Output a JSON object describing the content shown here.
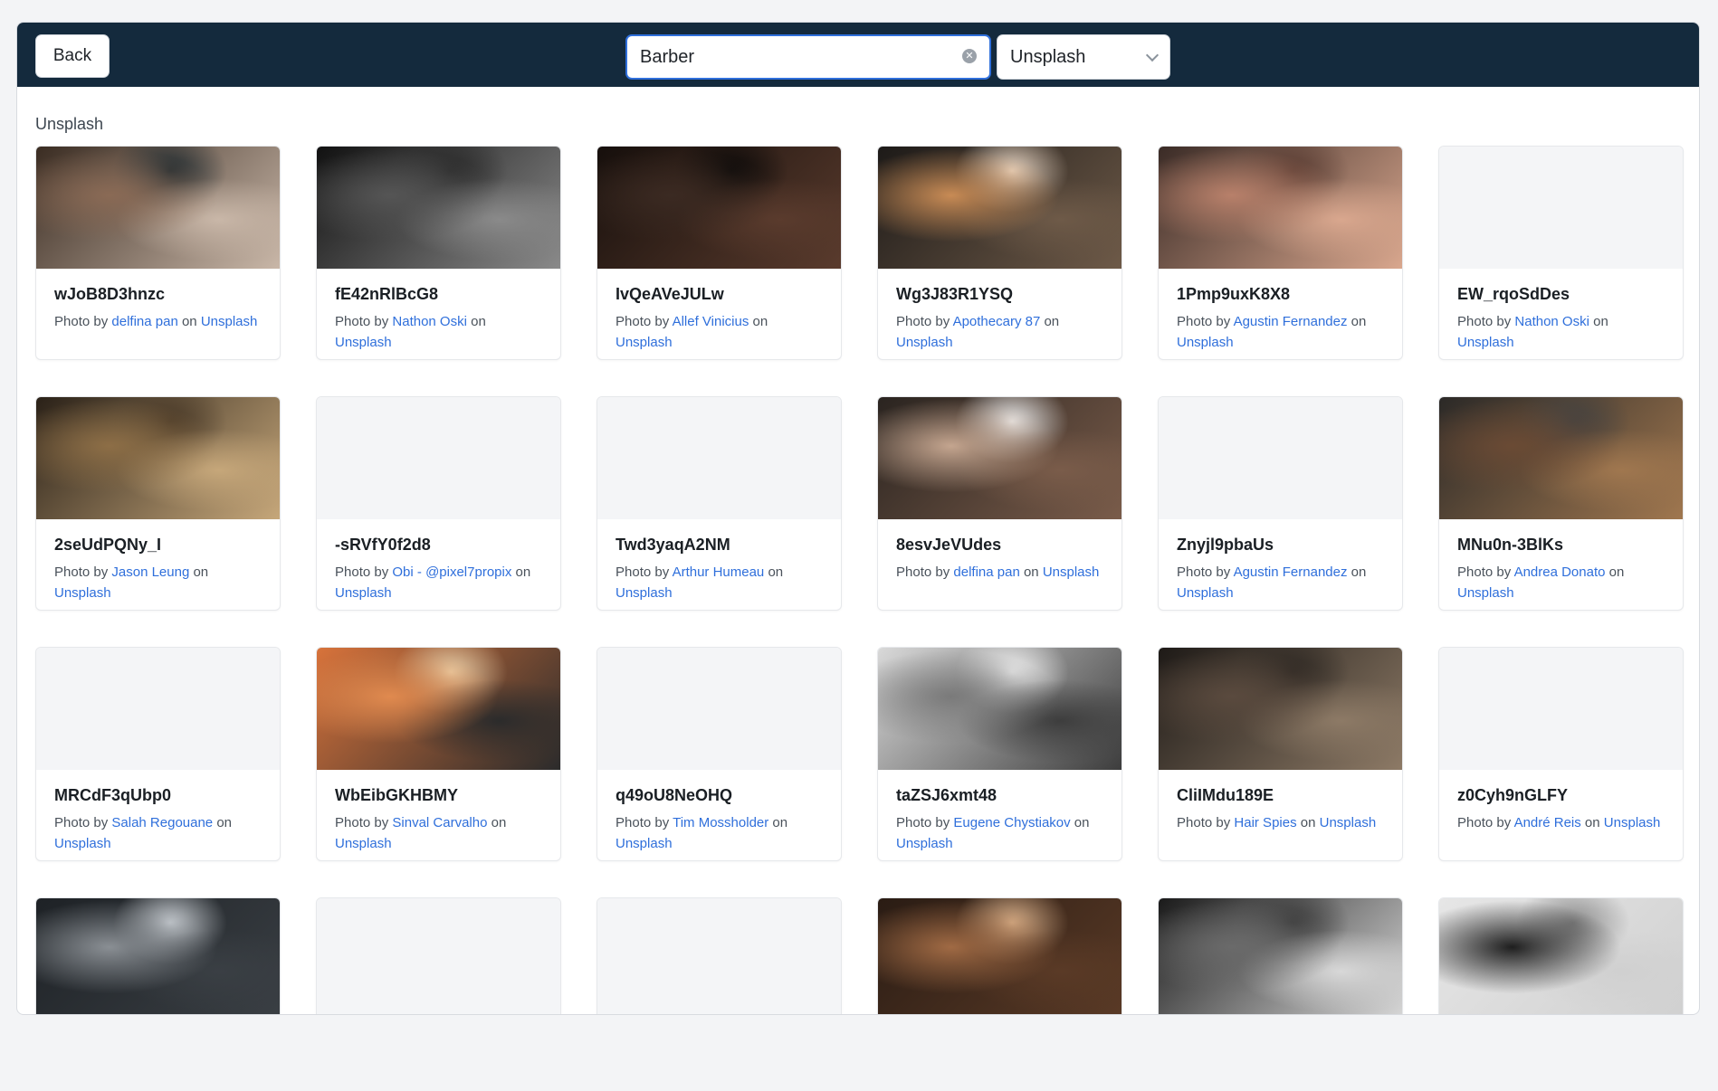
{
  "header": {
    "back_label": "Back",
    "search_value": "Barber",
    "source_selected": "Unsplash"
  },
  "section": {
    "title": "Unsplash"
  },
  "credit_text": {
    "prefix": "Photo by",
    "on": "on",
    "site": "Unsplash"
  },
  "cards": [
    {
      "id": "wJoB8D3hnzc",
      "author": "delfina pan",
      "thumb": "barber-cutting-hair",
      "colors": [
        "#3a2c22",
        "#8a6a55",
        "#c9b7a8",
        "#1f2a2f"
      ]
    },
    {
      "id": "fE42nRlBcG8",
      "author": "Nathon Oski",
      "thumb": "beard-trim-bw",
      "colors": [
        "#111111",
        "#555555",
        "#8a8a8a",
        "#2a2a2a"
      ]
    },
    {
      "id": "IvQeAVeJULw",
      "author": "Allef Vinicius",
      "thumb": "dark-shave",
      "colors": [
        "#160f0c",
        "#3b2a22",
        "#5a3b2d",
        "#0c0a09"
      ]
    },
    {
      "id": "Wg3J83R1YSQ",
      "author": "Apothecary 87",
      "thumb": "comb-and-products",
      "colors": [
        "#1d1a18",
        "#c88b55",
        "#6e5a48",
        "#e8d6c4"
      ]
    },
    {
      "id": "1Pmp9uxK8X8",
      "author": "Agustin Fernandez",
      "thumb": "tattoo-fade",
      "colors": [
        "#3a2b26",
        "#b8806a",
        "#d9a78e",
        "#5b3d33"
      ]
    },
    {
      "id": "EW_rqoSdDes",
      "author": "Nathon Oski",
      "thumb": "",
      "colors": []
    },
    {
      "id": "2seUdPQNy_I",
      "author": "Jason Leung",
      "thumb": "barbershop-interior",
      "colors": [
        "#2a2118",
        "#8d6e46",
        "#c6a77a",
        "#4a3a28"
      ]
    },
    {
      "id": "-sRVfY0f2d8",
      "author": "Obi - @pixel7propix",
      "thumb": "",
      "colors": []
    },
    {
      "id": "Twd3yaqA2NM",
      "author": "Arthur Humeau",
      "thumb": "",
      "colors": []
    },
    {
      "id": "8esvJeVUdes",
      "author": "delfina pan",
      "thumb": "hair-dryer",
      "colors": [
        "#2a2420",
        "#c4a58f",
        "#7a5c4a",
        "#eaeaea"
      ]
    },
    {
      "id": "Znyjl9pbaUs",
      "author": "Agustin Fernandez",
      "thumb": "",
      "colors": []
    },
    {
      "id": "MNu0n-3BlKs",
      "author": "Andrea Donato",
      "thumb": "tools-on-dark",
      "colors": [
        "#2b2927",
        "#6a4a34",
        "#a0774f",
        "#444240"
      ]
    },
    {
      "id": "MRCdF3qUbp0",
      "author": "Salah Regouane",
      "thumb": "",
      "colors": []
    },
    {
      "id": "WbEibGKHBMY",
      "author": "Sinval Carvalho",
      "thumb": "tools-orange",
      "colors": [
        "#d8733b",
        "#e08a4f",
        "#2b2b2b",
        "#e9cfa8"
      ]
    },
    {
      "id": "q49oU8NeOHQ",
      "author": "Tim Mossholder",
      "thumb": "",
      "colors": []
    },
    {
      "id": "taZSJ6xmt48",
      "author": "Eugene Chystiakov",
      "thumb": "portrait-bw",
      "colors": [
        "#d9d9d9",
        "#7a7a7a",
        "#3d3d3d",
        "#f2f2f2"
      ]
    },
    {
      "id": "CliIMdu189E",
      "author": "Hair Spies",
      "thumb": "haircut-closeup",
      "colors": [
        "#1e1a17",
        "#5a4a3e",
        "#8d7a66",
        "#2e2823"
      ]
    },
    {
      "id": "z0Cyh9nGLFY",
      "author": "André Reis",
      "thumb": "",
      "colors": []
    },
    {
      "id": "",
      "author": "",
      "thumb": "pomade-tin",
      "colors": [
        "#1e2226",
        "#8a8f94",
        "#3a3f44",
        "#c8cdd2"
      ]
    },
    {
      "id": "",
      "author": "",
      "thumb": "",
      "colors": []
    },
    {
      "id": "",
      "author": "",
      "thumb": "",
      "colors": []
    },
    {
      "id": "",
      "author": "",
      "thumb": "shave-warm",
      "colors": [
        "#2a1c14",
        "#a06a44",
        "#5a3a26",
        "#d8b08a"
      ]
    },
    {
      "id": "",
      "author": "",
      "thumb": "bw-barber",
      "colors": [
        "#1a1a1a",
        "#6a6a6a",
        "#d8d8d8",
        "#3a3a3a"
      ]
    },
    {
      "id": "",
      "author": "",
      "thumb": "barber-pole",
      "colors": [
        "#e6e6e6",
        "#1e1e1e",
        "#d0d0d0",
        "#8a8a8a"
      ]
    }
  ]
}
